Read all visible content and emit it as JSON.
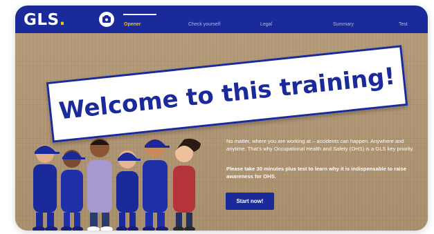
{
  "brand": {
    "name": "GLS",
    "dot": ".",
    "accent_color": "#f7c400",
    "nav_color": "#1b2a9a"
  },
  "nav": {
    "course_icon": "course-badge-icon",
    "items": [
      {
        "label": "Opener",
        "active": true
      },
      {
        "label": "Check yourself",
        "active": false
      },
      {
        "label": "Legal",
        "active": false
      },
      {
        "label": "Summary",
        "active": false
      },
      {
        "label": "Test",
        "active": false
      }
    ]
  },
  "hero": {
    "title": "Welcome to this training!",
    "intro": "No matter, where you are working at – accidents can happen. Anywhere and anytime. That's why Occupational Health and Safety (OHS) is a GLS key priority.",
    "emphasis": "Please take 30 minutes plus test to learn why it is indispensable to raise awareness for OHS.",
    "cta_label": "Start now!",
    "illustration": "cartoon-team-illustration"
  }
}
